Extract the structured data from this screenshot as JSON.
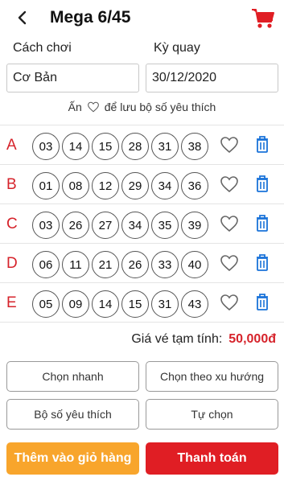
{
  "header": {
    "title": "Mega 6/45",
    "back_icon": "chevron-left-icon",
    "cart_icon": "shopping-cart-icon"
  },
  "form": {
    "play_label": "Cách chơi",
    "play_value": "Cơ Bản",
    "draw_label": "Kỳ quay",
    "draw_value": "30/12/2020"
  },
  "hint": {
    "prefix": "Ấn",
    "suffix": "để lưu bộ số yêu thích"
  },
  "rows": [
    {
      "letter": "A",
      "numbers": [
        "03",
        "14",
        "15",
        "28",
        "31",
        "38"
      ]
    },
    {
      "letter": "B",
      "numbers": [
        "01",
        "08",
        "12",
        "29",
        "34",
        "36"
      ]
    },
    {
      "letter": "C",
      "numbers": [
        "03",
        "26",
        "27",
        "34",
        "35",
        "39"
      ]
    },
    {
      "letter": "D",
      "numbers": [
        "06",
        "11",
        "21",
        "26",
        "33",
        "40"
      ]
    },
    {
      "letter": "E",
      "numbers": [
        "05",
        "09",
        "14",
        "15",
        "31",
        "43"
      ]
    }
  ],
  "price": {
    "label": "Giá vé tạm tính:",
    "amount": "50,000đ"
  },
  "options": {
    "quick_pick": "Chọn nhanh",
    "trend_pick": "Chọn theo xu hướng",
    "favorites": "Bộ số yêu thích",
    "self_pick": "Tự chọn"
  },
  "actions": {
    "add_to_cart": "Thêm vào giỏ hàng",
    "checkout": "Thanh toán"
  },
  "colors": {
    "accent_red": "#e01e24",
    "orange": "#f8a52c",
    "trash_blue": "#1a73d9"
  }
}
